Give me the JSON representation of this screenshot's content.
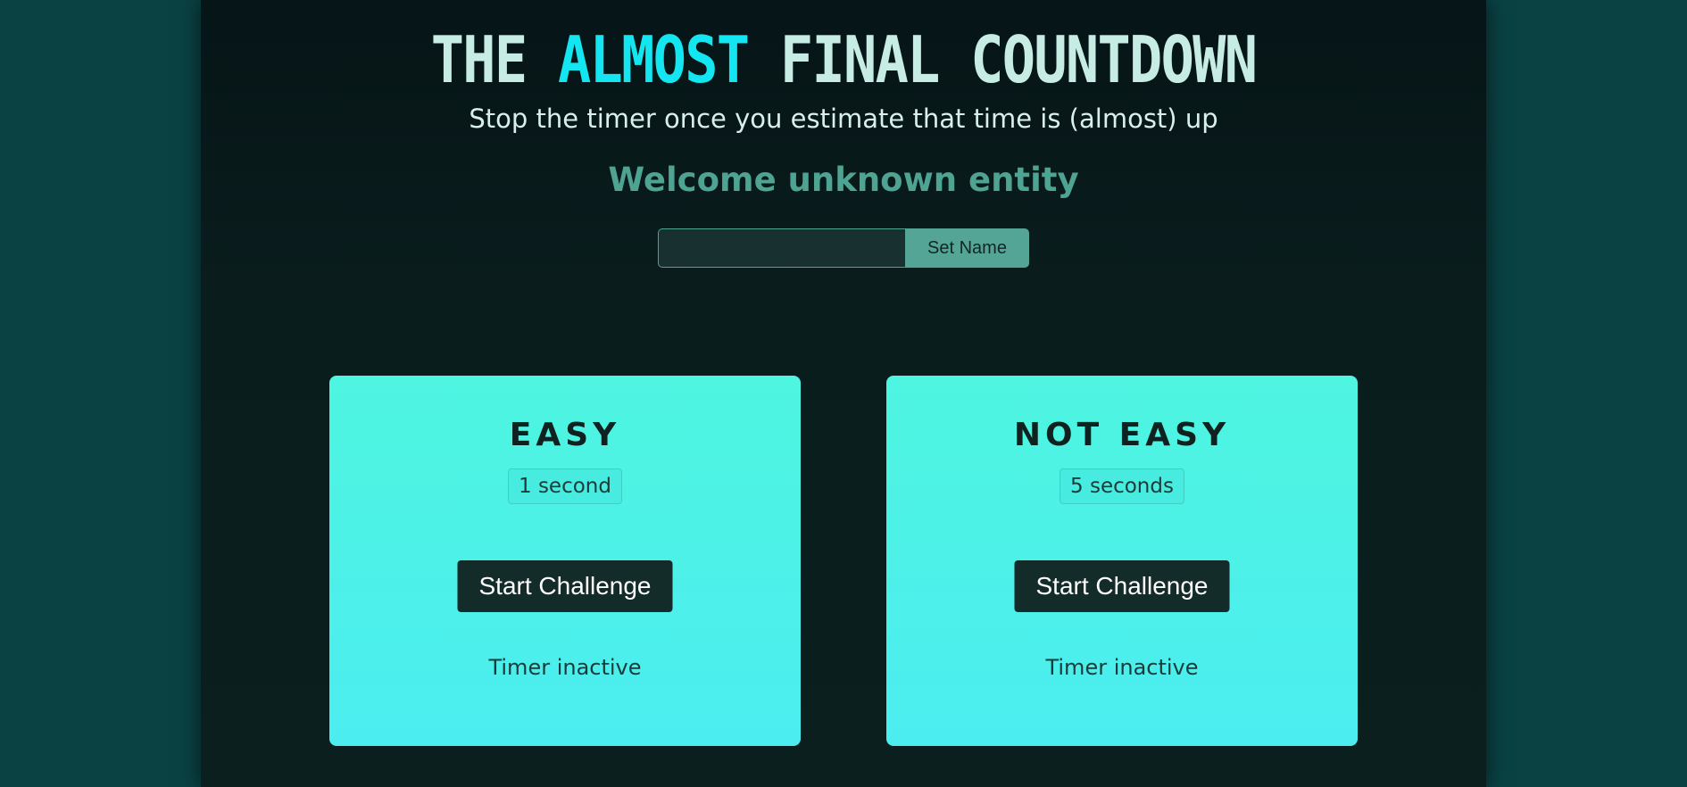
{
  "header": {
    "title_prefix": "THE",
    "title_accent": "ALMOST",
    "title_suffix": "FINAL COUNTDOWN",
    "subtitle": "Stop the timer once you estimate that time is (almost) up"
  },
  "welcome": {
    "text": "Welcome unknown entity"
  },
  "name_form": {
    "input_value": "",
    "button_label": "Set Name"
  },
  "challenges": [
    {
      "title": "EASY",
      "duration": "1 second",
      "button_label": "Start Challenge",
      "status": "Timer inactive"
    },
    {
      "title": "NOT EASY",
      "duration": "5 seconds",
      "button_label": "Start Challenge",
      "status": "Timer inactive"
    }
  ],
  "colors": {
    "outer_background": "#0a4244",
    "page_background": "#061517",
    "title_text": "#c6ece4",
    "title_accent": "#13e6f0",
    "welcome_text": "#4fa392",
    "card_gradient_top": "#4ef5e0",
    "card_gradient_bottom": "#4cedf0",
    "start_button": "#142c29",
    "set_name_button": "#55a596"
  }
}
